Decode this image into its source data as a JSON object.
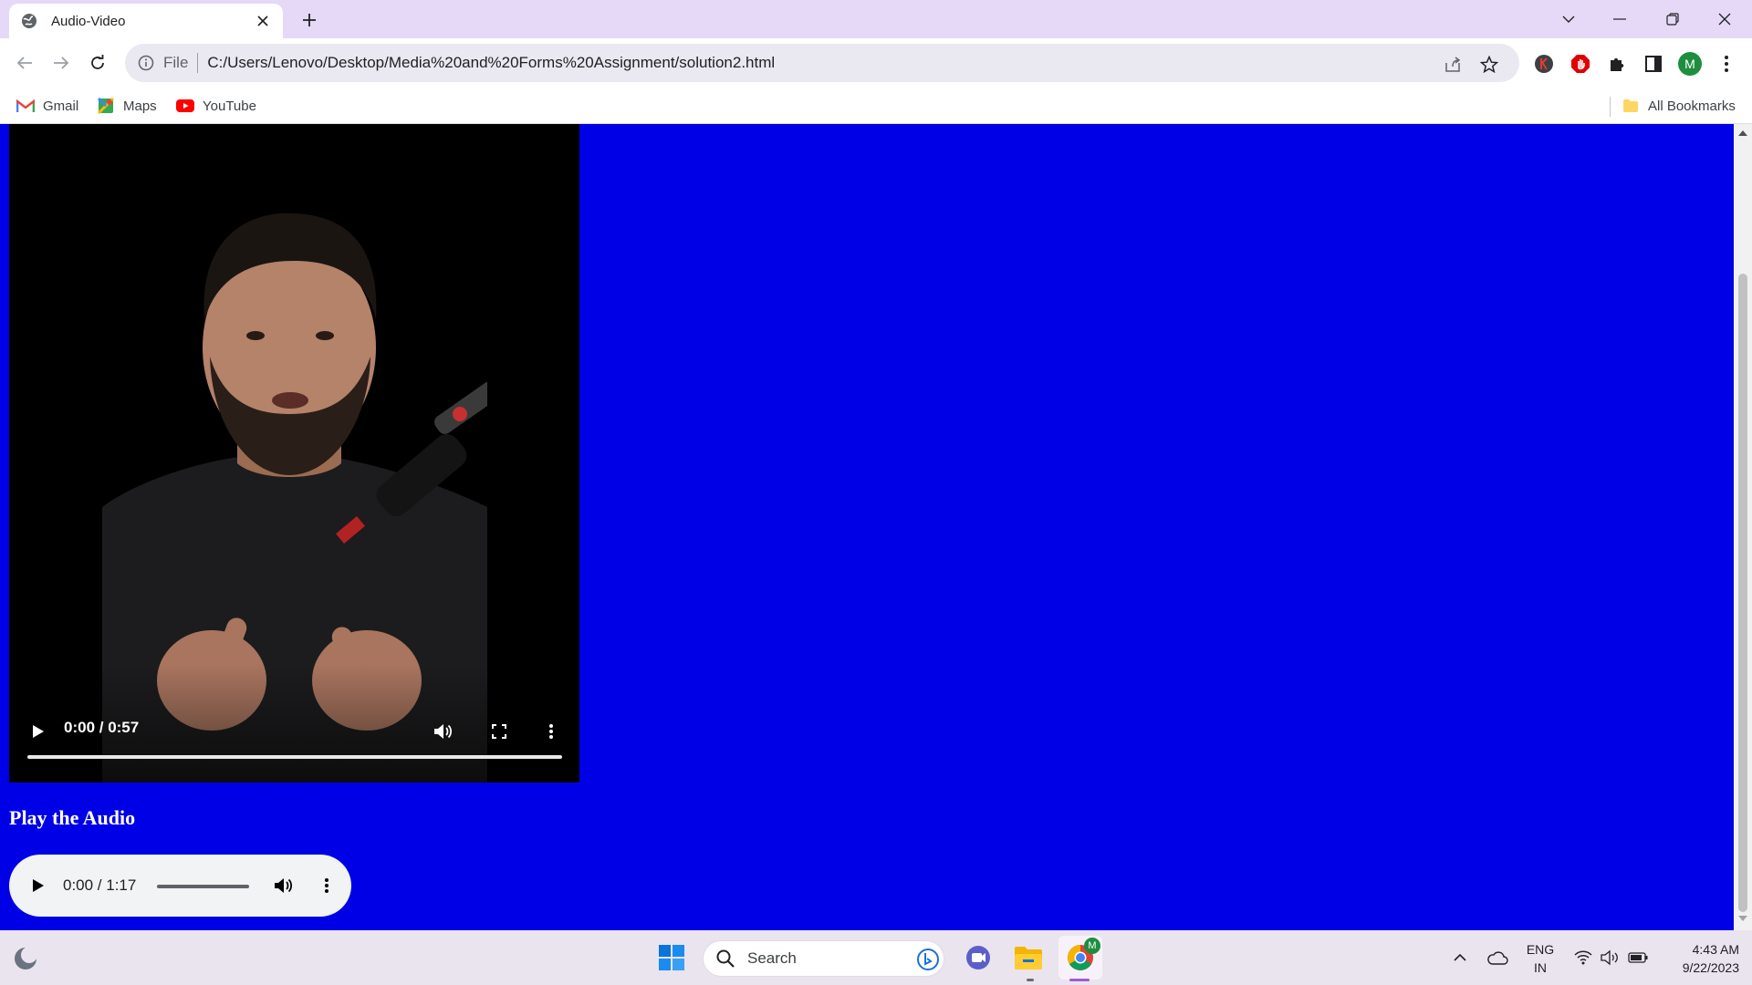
{
  "browser": {
    "tab": {
      "title": "Audio-Video",
      "favicon": "globe-icon"
    },
    "address": {
      "scheme": "File",
      "url": "C:/Users/Lenovo/Desktop/Media%20and%20Forms%20Assignment/solution2.html"
    },
    "profile_initial": "M",
    "accent": "#e5d9f7"
  },
  "bookmarks": {
    "items": [
      {
        "label": "Gmail",
        "icon": "gmail-icon"
      },
      {
        "label": "Maps",
        "icon": "maps-icon"
      },
      {
        "label": "YouTube",
        "icon": "youtube-icon"
      }
    ],
    "all_label": "All Bookmarks"
  },
  "page": {
    "background": "#0000e6",
    "video": {
      "time": "0:00 / 0:57"
    },
    "audio_heading": "Play the Audio",
    "audio": {
      "time": "0:00 / 1:17"
    }
  },
  "taskbar": {
    "search_label": "Search",
    "lang_top": "ENG",
    "lang_bottom": "IN",
    "time": "4:43 AM",
    "date": "9/22/2023",
    "chrome_badge": "M"
  }
}
